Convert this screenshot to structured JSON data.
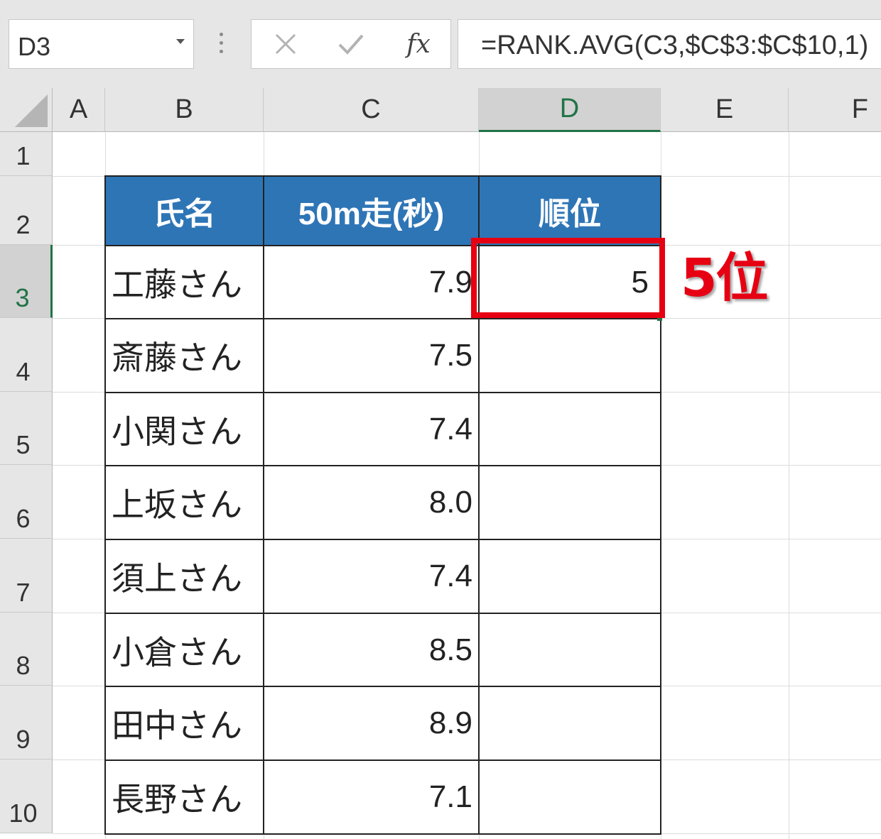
{
  "formula_bar": {
    "name_box": "D3",
    "fx_label": "fx",
    "formula": "=RANK.AVG(C3,$C$3:$C$10,1)"
  },
  "columns": [
    "A",
    "B",
    "C",
    "D",
    "E",
    "F"
  ],
  "selected_column": "D",
  "rows": [
    "1",
    "2",
    "3",
    "4",
    "5",
    "6",
    "7",
    "8",
    "9",
    "10"
  ],
  "selected_row": "3",
  "table": {
    "headers": [
      "氏名",
      "50m走(秒)",
      "順位"
    ],
    "records": [
      {
        "name": "工藤さん",
        "time": "7.9",
        "rank": "5"
      },
      {
        "name": "斎藤さん",
        "time": "7.5",
        "rank": ""
      },
      {
        "name": "小関さん",
        "time": "7.4",
        "rank": ""
      },
      {
        "name": "上坂さん",
        "time": "8.0",
        "rank": ""
      },
      {
        "name": "須上さん",
        "time": "7.4",
        "rank": ""
      },
      {
        "name": "小倉さん",
        "time": "8.5",
        "rank": ""
      },
      {
        "name": "田中さん",
        "time": "8.9",
        "rank": ""
      },
      {
        "name": "長野さん",
        "time": "7.1",
        "rank": ""
      }
    ]
  },
  "annotation": "5位",
  "colors": {
    "header_fill": "#2e75b6",
    "highlight": "#e60012",
    "selection": "#217346"
  }
}
